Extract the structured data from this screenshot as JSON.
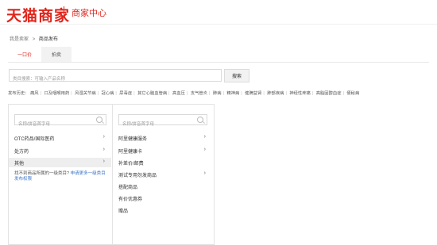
{
  "header": {
    "logo": "天猫商家",
    "subtitle": "商家中心"
  },
  "breadcrumb": {
    "root": "我是卖家",
    "separator": ">",
    "current": "商品发布"
  },
  "tabs": [
    {
      "label": "一口价",
      "active": true
    },
    {
      "label": "拍卖",
      "active": false
    }
  ],
  "search": {
    "placeholder": "类目搜索：可输入产品名称",
    "value": "",
    "button": "搜索"
  },
  "history": {
    "label": "发布历史：",
    "items": [
      "痛风",
      "口及咽喉用药",
      "风湿关节病",
      "冠心病",
      "尿毒症",
      "其它心脑血管病",
      "高血压",
      "支气管炎",
      "肺病",
      "精神病",
      "健脾益肾",
      "肺部疾病",
      "神经性疼痛",
      "高脂固醇血症",
      "便秘病"
    ]
  },
  "panel1": {
    "search_placeholder": "名称/拼音首字母",
    "items": [
      {
        "label": "OTC药品/国际医药",
        "has_children": true,
        "selected": false
      },
      {
        "label": "处方药",
        "has_children": true,
        "selected": false
      },
      {
        "label": "其他",
        "has_children": true,
        "selected": true
      }
    ],
    "hint_text": "找不到商品所属的一级类目?",
    "hint_link": "申请更多一级类目发布权限"
  },
  "panel2": {
    "search_placeholder": "名称/拼音首字母",
    "items": [
      {
        "label": "阿里健康服务",
        "has_children": true
      },
      {
        "label": "阿里健康卡",
        "has_children": true
      },
      {
        "label": "补差价/邮费",
        "has_children": false
      },
      {
        "label": "测试专用勿发商品",
        "has_children": true
      },
      {
        "label": "搭配商品",
        "has_children": false
      },
      {
        "label": "有价优惠券",
        "has_children": false
      },
      {
        "label": "赠品",
        "has_children": false
      }
    ]
  },
  "colors": {
    "brand": "#e1251b",
    "link": "#3a74c9"
  }
}
